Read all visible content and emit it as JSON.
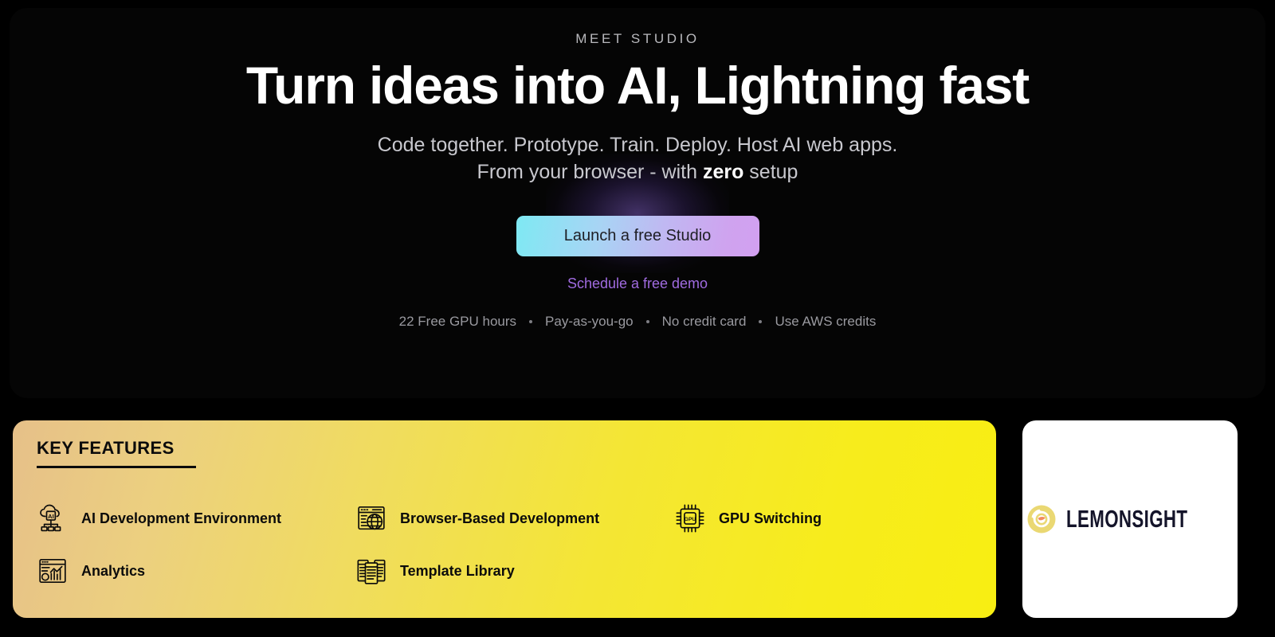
{
  "hero": {
    "eyebrow": "MEET STUDIO",
    "headline": "Turn ideas into AI, Lightning fast",
    "subhead_line1": "Code together. Prototype. Train. Deploy. Host AI web apps.",
    "subhead_line2_before": "From your browser - with ",
    "subhead_line2_bold": "zero",
    "subhead_line2_after": " setup",
    "cta_label": "Launch a free Studio",
    "demo_link_label": "Schedule a free demo",
    "perks": [
      "22 Free GPU hours",
      "Pay-as-you-go",
      "No credit card",
      "Use AWS credits"
    ],
    "colors": {
      "card_bg": "#050505",
      "cta_gradient_start": "#7ee9f3",
      "cta_gradient_end": "#d2a0f0",
      "demo_link": "#a06be0",
      "glow": "#966beb"
    }
  },
  "features": {
    "title": "KEY FEATURES",
    "items": [
      {
        "label": "AI Development Environment",
        "icon": "ai-cloud-icon"
      },
      {
        "label": "Browser-Based Development",
        "icon": "browser-globe-icon"
      },
      {
        "label": "GPU Switching",
        "icon": "gpu-chip-icon"
      },
      {
        "label": "Analytics",
        "icon": "analytics-chart-icon"
      },
      {
        "label": "Template Library",
        "icon": "template-windows-icon"
      }
    ],
    "colors": {
      "gradient_start": "#e6c089",
      "gradient_end": "#f8ee12",
      "text": "#0b0b0b"
    }
  },
  "brand": {
    "wordmark": "LEMONSIGHT",
    "logo_icon": "lemon-spiral-icon",
    "colors": {
      "card_bg": "#ffffff",
      "wordmark": "#14142a",
      "spiral_outer": "#e8d96a",
      "spiral_inner": "#f08a5d"
    }
  }
}
